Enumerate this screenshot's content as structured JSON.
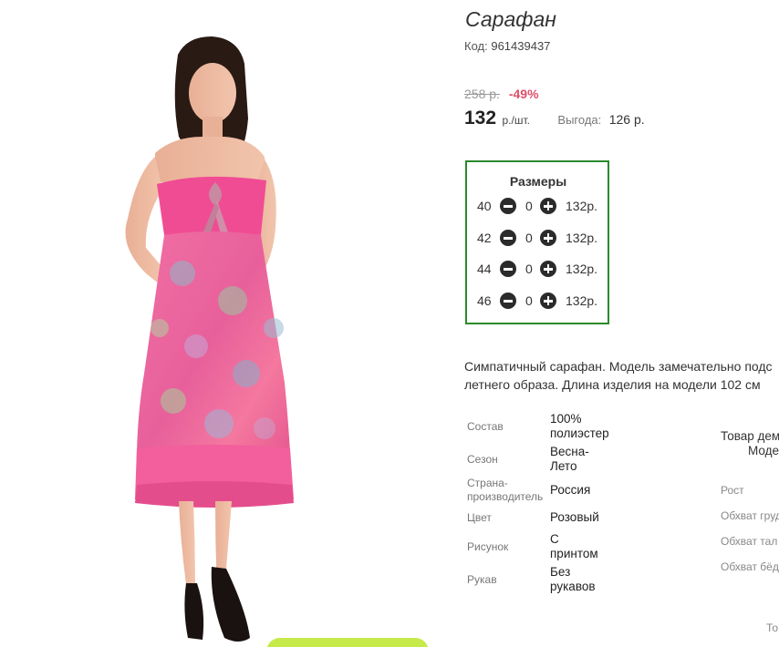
{
  "product": {
    "title": "Сарафан",
    "code_label": "Код:",
    "code_value": "961439437"
  },
  "pricing": {
    "old_price": "258 р.",
    "discount": "-49%",
    "price": "132",
    "unit": "р./шт.",
    "benefit_label": "Выгода:",
    "benefit_value": "126 р."
  },
  "sizes": {
    "title": "Размеры",
    "rows": [
      {
        "size": "40",
        "qty": "0",
        "price": "132р."
      },
      {
        "size": "42",
        "qty": "0",
        "price": "132р."
      },
      {
        "size": "44",
        "qty": "0",
        "price": "132р."
      },
      {
        "size": "46",
        "qty": "0",
        "price": "132р."
      }
    ]
  },
  "description": {
    "line1": "Симпатичный сарафан. Модель замечательно подс",
    "line2": "летнего образа. Длина изделия на модели 102 см"
  },
  "properties": [
    {
      "key": "Состав",
      "value_l1": "100%",
      "value_l2": "полиэстер"
    },
    {
      "key": "Сезон",
      "value_l1": "Весна-",
      "value_l2": "Лето"
    },
    {
      "key_l1": "Страна-",
      "key_l2": "производитель",
      "value_l1": "Россия"
    },
    {
      "key": "Цвет",
      "value_l1": "Розовый"
    },
    {
      "key": "Рисунок",
      "value_l1": "С",
      "value_l2": "принтом"
    },
    {
      "key": "Рукав",
      "value_l1": "Без",
      "value_l2": "рукавов"
    }
  ],
  "model_info": {
    "title": "Товар дем",
    "subtitle": "Моде",
    "rows": [
      "Рост",
      "Обхват груд",
      "Обхват тал",
      "Обхват бёд"
    ],
    "footer": "То"
  },
  "colors": {
    "accent_green": "#2b8a2b",
    "discount_red": "#e0506a",
    "dress_pink": "#f0609a",
    "cart_button": "#c6ea4a"
  },
  "icons": {
    "minus": "minus-circle-icon",
    "plus": "plus-circle-icon"
  }
}
